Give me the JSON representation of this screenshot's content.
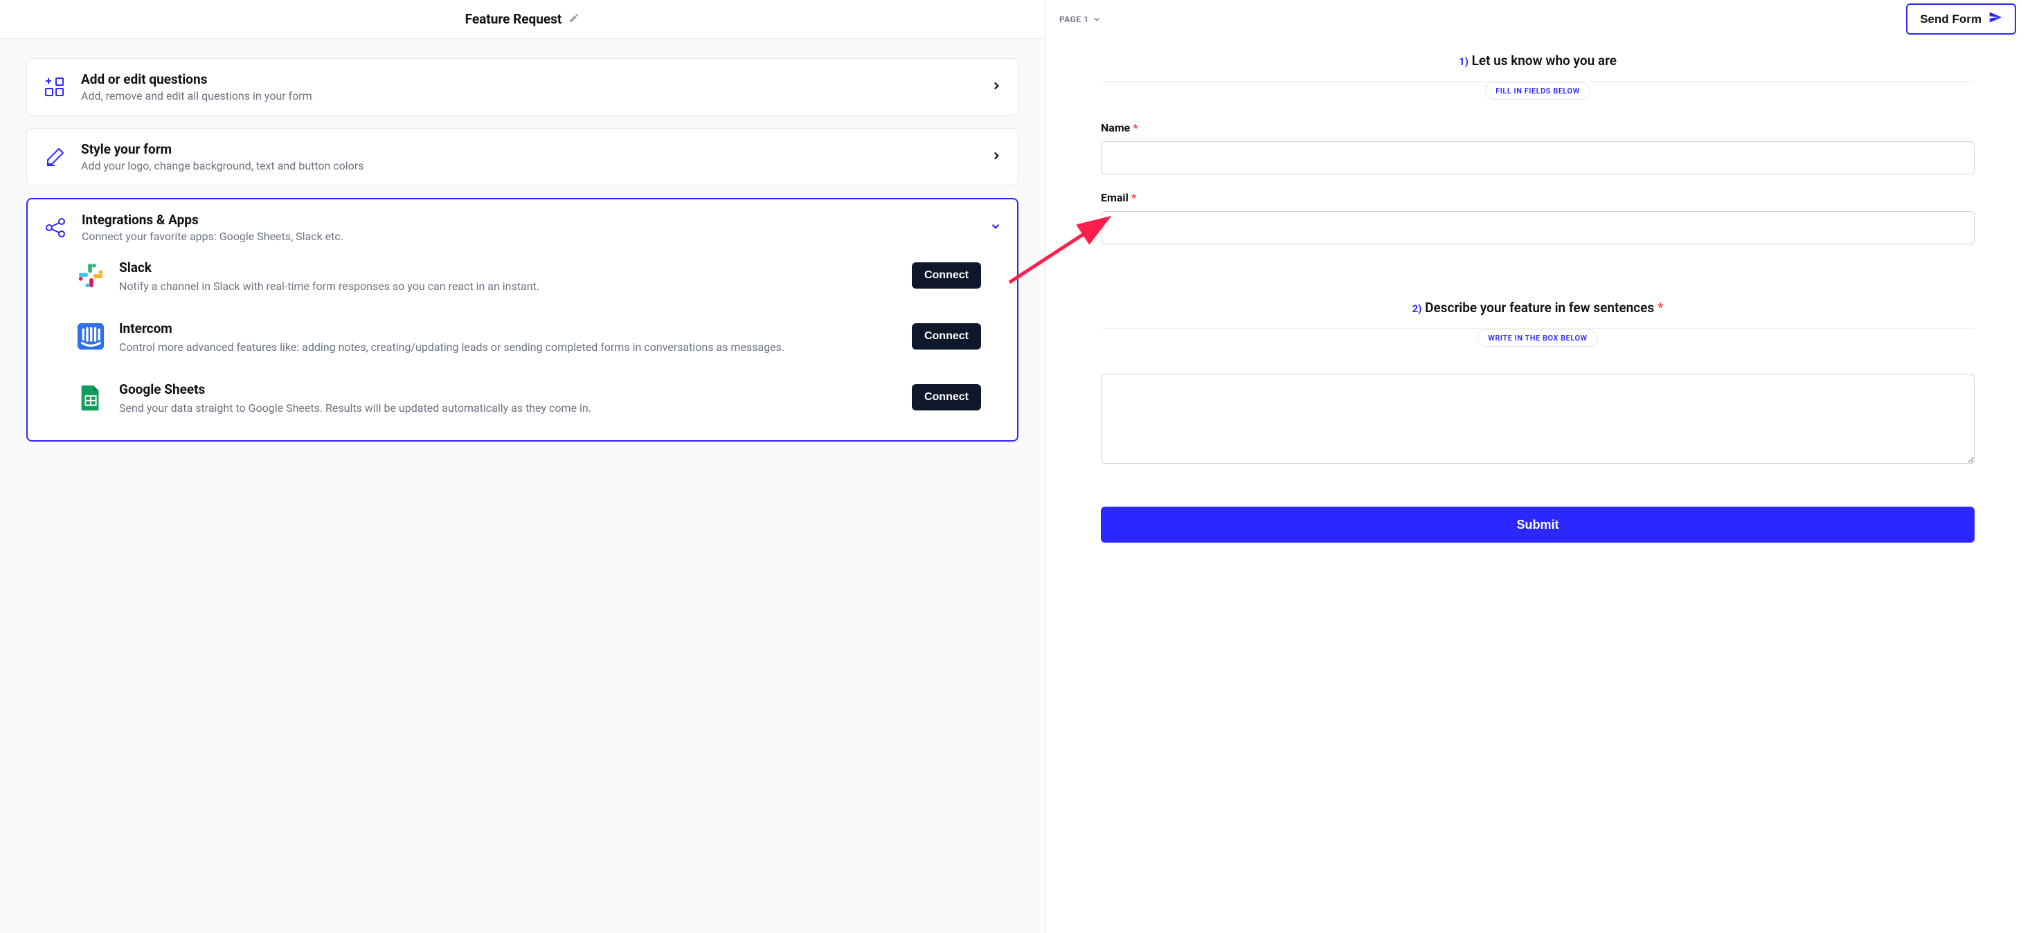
{
  "header": {
    "title": "Feature Request"
  },
  "sections": {
    "questions": {
      "title": "Add or edit questions",
      "subtitle": "Add, remove and edit all questions in your form"
    },
    "style": {
      "title": "Style your form",
      "subtitle": "Add your logo, change background, text and button colors"
    },
    "integrations": {
      "title": "Integrations & Apps",
      "subtitle": "Connect your favorite apps: Google Sheets, Slack etc."
    }
  },
  "integrations": [
    {
      "name": "Slack",
      "desc": "Notify a channel in Slack with real-time form responses so you can react in an instant.",
      "cta": "Connect"
    },
    {
      "name": "Intercom",
      "desc": "Control more advanced features like: adding notes, creating/updating leads or sending completed forms in conversations as messages.",
      "cta": "Connect"
    },
    {
      "name": "Google Sheets",
      "desc": "Send your data straight to Google Sheets. Results will be updated automatically as they come in.",
      "cta": "Connect"
    }
  ],
  "rightHeader": {
    "pageLabel": "PAGE 1",
    "sendForm": "Send Form"
  },
  "form": {
    "sections": [
      {
        "number": "1)",
        "title": "Let us know who you are",
        "hint": "FILL IN FIELDS BELOW"
      },
      {
        "number": "2)",
        "title": "Describe your feature in few sentences",
        "required": true,
        "hint": "WRITE IN THE BOX BELOW"
      }
    ],
    "fields": {
      "name": {
        "label": "Name",
        "required": true
      },
      "email": {
        "label": "Email",
        "required": true
      }
    },
    "submit": "Submit"
  }
}
